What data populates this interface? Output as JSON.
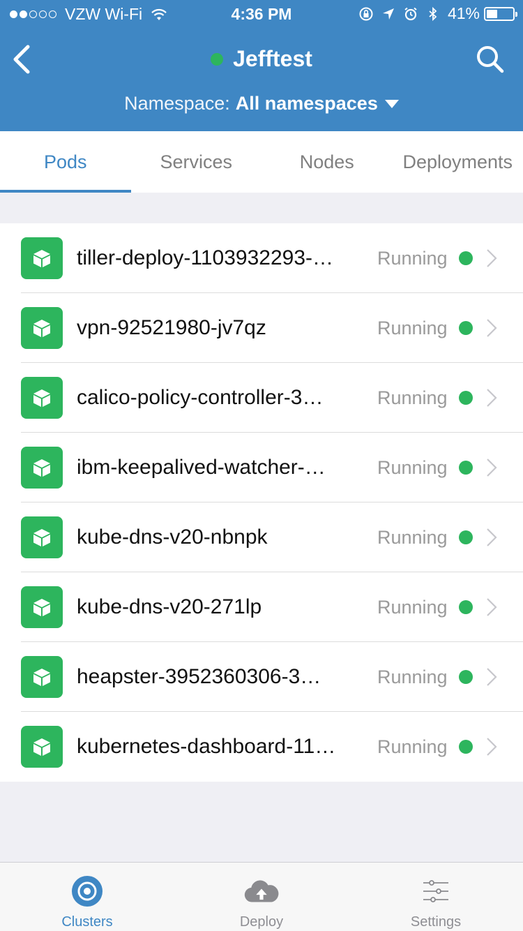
{
  "status_bar": {
    "carrier": "VZW Wi-Fi",
    "time": "4:36 PM",
    "battery_percent": "41%",
    "battery_level": 0.41,
    "signal_bars_filled": 2,
    "signal_bars_total": 5
  },
  "header": {
    "title": "Jefftest",
    "cluster_status_color": "#2db55d",
    "namespace_label": "Namespace:",
    "namespace_value": "All namespaces",
    "background_color": "#3f87c4"
  },
  "tabs": [
    {
      "label": "Pods",
      "active": true
    },
    {
      "label": "Services",
      "active": false
    },
    {
      "label": "Nodes",
      "active": false
    },
    {
      "label": "Deployments",
      "active": false
    }
  ],
  "pods": [
    {
      "name": "tiller-deploy-1103932293-…",
      "status": "Running"
    },
    {
      "name": "vpn-92521980-jv7qz",
      "status": "Running"
    },
    {
      "name": "calico-policy-controller-3…",
      "status": "Running"
    },
    {
      "name": "ibm-keepalived-watcher-…",
      "status": "Running"
    },
    {
      "name": "kube-dns-v20-nbnpk",
      "status": "Running"
    },
    {
      "name": "kube-dns-v20-271lp",
      "status": "Running"
    },
    {
      "name": "heapster-3952360306-3…",
      "status": "Running"
    },
    {
      "name": "kubernetes-dashboard-11…",
      "status": "Running"
    }
  ],
  "pod_icon": "cube-icon",
  "colors": {
    "accent": "#3f87c4",
    "running_green": "#2db55d",
    "pod_icon_bg": "#2db55d"
  },
  "tabbar": [
    {
      "label": "Clusters",
      "icon": "clusters-icon",
      "active": true
    },
    {
      "label": "Deploy",
      "icon": "cloud-upload-icon",
      "active": false
    },
    {
      "label": "Settings",
      "icon": "sliders-icon",
      "active": false
    }
  ]
}
